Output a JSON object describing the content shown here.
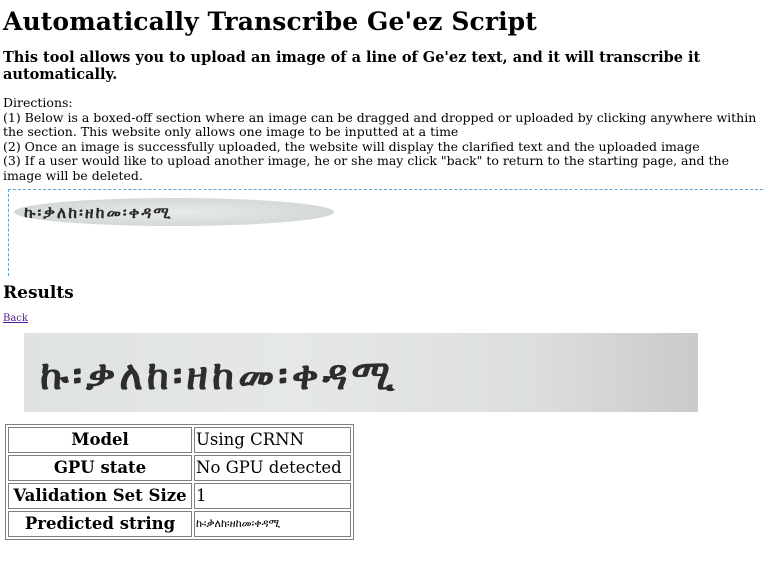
{
  "page": {
    "title": "Automatically Transcribe Ge'ez Script",
    "subtitle": "This tool allows you to upload an image of a line of Ge'ez text, and it will transcribe it automatically.",
    "directions": {
      "heading": "Directions:",
      "steps": [
        "(1) Below is a boxed-off section where an image can be dragged and dropped or uploaded by clicking anywhere within the section. This website only allows one image to be inputted at a time",
        "(2) Once an image is successfully uploaded, the website will display the clarified text and the uploaded image",
        "(3) If a user would like to upload another image, he or she may click \"back\" to return to the starting page, and the image will be deleted."
      ]
    },
    "upload": {
      "thumbnail_text": "ኩ፡ቃለከ፡ዘከመ፡ቀዳሚ"
    }
  },
  "results": {
    "heading": "Results",
    "back_label": "Back",
    "image_text": "ኩ፡ቃለከ፡ዘከመ፡ቀዳሚ",
    "rows": [
      {
        "label": "Model",
        "value": "Using CRNN"
      },
      {
        "label": "GPU state",
        "value": "No GPU detected"
      },
      {
        "label": "Validation Set Size",
        "value": "1"
      },
      {
        "label": "Predicted string",
        "value": "ኩ፡ቃለከ፡ዘከመ፡ቀዳሚ"
      }
    ]
  },
  "colors": {
    "dropzone_border": "#5fa3d3",
    "link_visited": "#551a8b",
    "table_border": "#808080"
  }
}
